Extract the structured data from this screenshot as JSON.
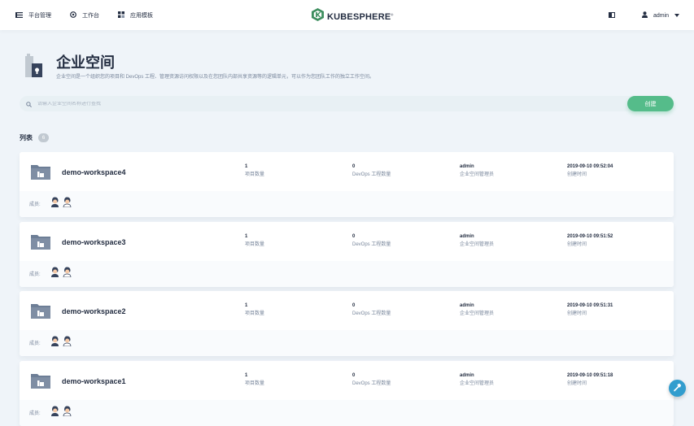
{
  "nav": {
    "platform": "平台管理",
    "workbench": "工作台",
    "app_templates": "应用模板"
  },
  "logo": {
    "text": "KUBESPHERE",
    "mark": "®"
  },
  "user": {
    "name": "admin"
  },
  "hero": {
    "title": "企业空间",
    "description": "企业空间是一个组织您的项目和 DevOps 工程、管理资源访问权限以及在您团队内部共享资源等的逻辑单元，可以作为您团队工作的独立工作空间。"
  },
  "search": {
    "placeholder": "请输入企业空间名称进行查找",
    "value": ""
  },
  "create_label": "创建",
  "list": {
    "title": "列表",
    "count": "6"
  },
  "members_label": "成员:",
  "workspaces": [
    {
      "name": "demo-workspace4",
      "projects": "1",
      "projects_label": "项目数量",
      "devops": "0",
      "devops_label": "DevOps 工程数量",
      "manager": "admin",
      "manager_label": "企业空间管理员",
      "created": "2019-09-10 09:52:04",
      "created_label": "创建时间"
    },
    {
      "name": "demo-workspace3",
      "projects": "1",
      "projects_label": "项目数量",
      "devops": "0",
      "devops_label": "DevOps 工程数量",
      "manager": "admin",
      "manager_label": "企业空间管理员",
      "created": "2019-09-10 09:51:52",
      "created_label": "创建时间"
    },
    {
      "name": "demo-workspace2",
      "projects": "1",
      "projects_label": "项目数量",
      "devops": "0",
      "devops_label": "DevOps 工程数量",
      "manager": "admin",
      "manager_label": "企业空间管理员",
      "created": "2019-09-10 09:51:31",
      "created_label": "创建时间"
    },
    {
      "name": "demo-workspace1",
      "projects": "1",
      "projects_label": "项目数量",
      "devops": "0",
      "devops_label": "DevOps 工程数量",
      "manager": "admin",
      "manager_label": "企业空间管理员",
      "created": "2019-09-10 09:51:18",
      "created_label": "创建时间"
    }
  ],
  "colors": {
    "accent": "#55bc8a",
    "background": "#eff4f9",
    "text": "#242e42",
    "muted": "#79879c",
    "fab": "#329dce"
  },
  "icons": [
    "hamburger-icon",
    "workbench-icon",
    "app-templates-icon",
    "kubesphere-logo-icon",
    "panel-icon",
    "user-icon",
    "chevron-down-icon",
    "workspace-icon",
    "search-icon",
    "member-avatar",
    "hammer-icon"
  ]
}
